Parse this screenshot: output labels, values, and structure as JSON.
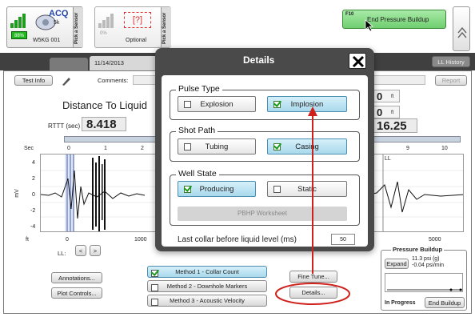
{
  "top": {
    "sensor1": {
      "badge": "ACQ",
      "sub": "5k",
      "serial": "W5KG 001",
      "battery": "88%"
    },
    "sensor2": {
      "placeholder": "[?]",
      "name": "Optional",
      "battery": "0%"
    },
    "pick_sensor": "Pick a Sensor",
    "f10_key": "F10",
    "end_pressure_label": "End Pressure Buildup"
  },
  "tabbar": {
    "date": "11/14/2013",
    "history": "LL History"
  },
  "toolbar": {
    "test_info": "Test Info",
    "comments": "Comments:",
    "report": "Report"
  },
  "main": {
    "distance_label": "Distance To Liquid",
    "rttt_label": "RTTT (sec)",
    "rttt_value": "8.418",
    "right_value_1": "0",
    "right_value_2": "0",
    "right_unit": "ft",
    "right_big": "16.25"
  },
  "chart": {
    "sec_label": "Sec",
    "ft_label": "ft",
    "mv_label": "mV",
    "ll_marker": "LL",
    "top_ticks": [
      "0",
      "1",
      "2",
      "9",
      "10"
    ],
    "y_ticks": [
      "4",
      "2",
      "0",
      "-2",
      "-4"
    ],
    "bottom_ticks": [
      "0",
      "1000",
      "5000"
    ]
  },
  "controls": {
    "ll_label": "LL:",
    "annotations": "Annotations...",
    "plot_controls": "Plot Controls...",
    "method1": "Method 1 - Collar Count",
    "method2": "Method 2 - Downhole Markers",
    "method3": "Method 3 - Acoustic Velocity",
    "fine_tune": "Fine Tune...",
    "details": "Details..."
  },
  "pressure": {
    "title": "Pressure Buildup",
    "expand": "Expand",
    "reading1": "11.3 psi (g)",
    "reading2": "-0.04 psi/min",
    "status": "In Progress",
    "end_button": "End Buildup"
  },
  "dialog": {
    "title": "Details",
    "pulse_type": {
      "label": "Pulse Type",
      "options": [
        "Explosion",
        "Implosion"
      ],
      "selected": "Implosion"
    },
    "shot_path": {
      "label": "Shot Path",
      "options": [
        "Tubing",
        "Casing"
      ],
      "selected": "Casing"
    },
    "well_state": {
      "label": "Well State",
      "options": [
        "Producing",
        "Static"
      ],
      "selected": "Producing"
    },
    "pbhp": "PBHP Worksheet",
    "last_collar_label": "Last collar before liquid level (ms)",
    "last_collar_value": "50"
  },
  "colors": {
    "accent_green": "#7ed67e",
    "annotation_red": "#d0201c",
    "selected_blue": "#a9d9ec",
    "dialog_frame": "#555555"
  }
}
